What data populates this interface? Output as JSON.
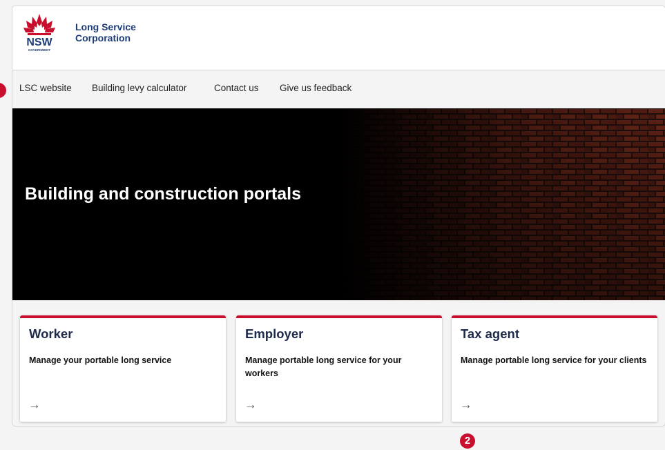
{
  "header": {
    "logo_wordmark": "NSW",
    "logo_sub": "GOVERNMENT",
    "org_line1": "Long Service",
    "org_line2": "Corporation"
  },
  "nav": {
    "items": [
      {
        "label": "LSC website"
      },
      {
        "label": "Building levy calculator"
      },
      {
        "label": "Contact us"
      },
      {
        "label": "Give us feedback"
      }
    ]
  },
  "hero": {
    "title": "Building and construction portals"
  },
  "cards": [
    {
      "title": "Worker",
      "description": "Manage your portable long service",
      "arrow": "→"
    },
    {
      "title": "Employer",
      "description": "Manage portable long service for your workers",
      "arrow": "→"
    },
    {
      "title": "Tax agent",
      "description": "Manage portable long service for your clients",
      "arrow": "→"
    }
  ],
  "annotations": {
    "badge_2": "2"
  },
  "colors": {
    "accent_red": "#c8102e",
    "navy": "#1e3c78"
  }
}
